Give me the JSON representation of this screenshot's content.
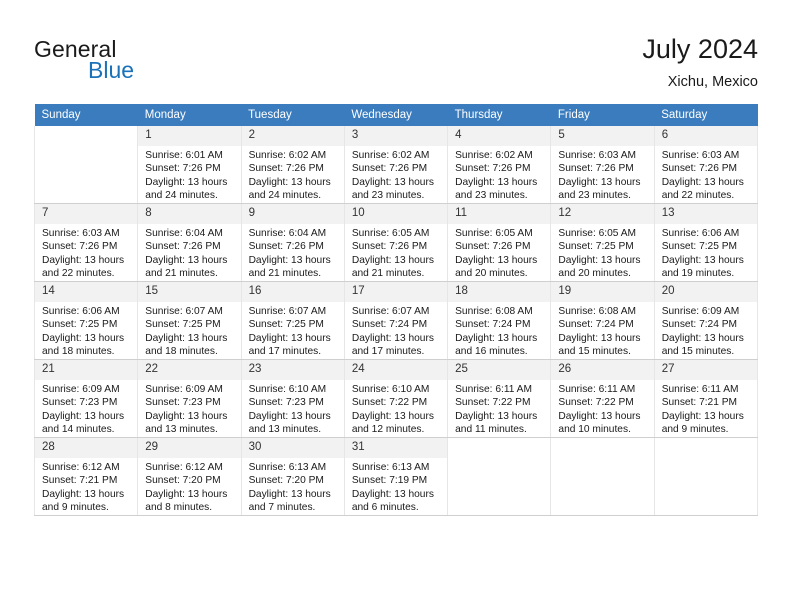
{
  "brand": {
    "name_primary": "General",
    "name_secondary": "Blue",
    "accent_color": "#1B72B8",
    "logo_icon": "triangle-flag-icon"
  },
  "header": {
    "title": "July 2024",
    "subtitle": "Xichu, Mexico"
  },
  "calendar": {
    "header_color": "#3A7CBE",
    "weekday_headers": [
      "Sunday",
      "Monday",
      "Tuesday",
      "Wednesday",
      "Thursday",
      "Friday",
      "Saturday"
    ],
    "weeks": [
      [
        {
          "day": "",
          "lines": [
            "",
            "",
            "",
            ""
          ]
        },
        {
          "day": "1",
          "lines": [
            "Sunrise: 6:01 AM",
            "Sunset: 7:26 PM",
            "Daylight: 13 hours",
            "and 24 minutes."
          ]
        },
        {
          "day": "2",
          "lines": [
            "Sunrise: 6:02 AM",
            "Sunset: 7:26 PM",
            "Daylight: 13 hours",
            "and 24 minutes."
          ]
        },
        {
          "day": "3",
          "lines": [
            "Sunrise: 6:02 AM",
            "Sunset: 7:26 PM",
            "Daylight: 13 hours",
            "and 23 minutes."
          ]
        },
        {
          "day": "4",
          "lines": [
            "Sunrise: 6:02 AM",
            "Sunset: 7:26 PM",
            "Daylight: 13 hours",
            "and 23 minutes."
          ]
        },
        {
          "day": "5",
          "lines": [
            "Sunrise: 6:03 AM",
            "Sunset: 7:26 PM",
            "Daylight: 13 hours",
            "and 23 minutes."
          ]
        },
        {
          "day": "6",
          "lines": [
            "Sunrise: 6:03 AM",
            "Sunset: 7:26 PM",
            "Daylight: 13 hours",
            "and 22 minutes."
          ]
        }
      ],
      [
        {
          "day": "7",
          "lines": [
            "Sunrise: 6:03 AM",
            "Sunset: 7:26 PM",
            "Daylight: 13 hours",
            "and 22 minutes."
          ]
        },
        {
          "day": "8",
          "lines": [
            "Sunrise: 6:04 AM",
            "Sunset: 7:26 PM",
            "Daylight: 13 hours",
            "and 21 minutes."
          ]
        },
        {
          "day": "9",
          "lines": [
            "Sunrise: 6:04 AM",
            "Sunset: 7:26 PM",
            "Daylight: 13 hours",
            "and 21 minutes."
          ]
        },
        {
          "day": "10",
          "lines": [
            "Sunrise: 6:05 AM",
            "Sunset: 7:26 PM",
            "Daylight: 13 hours",
            "and 21 minutes."
          ]
        },
        {
          "day": "11",
          "lines": [
            "Sunrise: 6:05 AM",
            "Sunset: 7:26 PM",
            "Daylight: 13 hours",
            "and 20 minutes."
          ]
        },
        {
          "day": "12",
          "lines": [
            "Sunrise: 6:05 AM",
            "Sunset: 7:25 PM",
            "Daylight: 13 hours",
            "and 20 minutes."
          ]
        },
        {
          "day": "13",
          "lines": [
            "Sunrise: 6:06 AM",
            "Sunset: 7:25 PM",
            "Daylight: 13 hours",
            "and 19 minutes."
          ]
        }
      ],
      [
        {
          "day": "14",
          "lines": [
            "Sunrise: 6:06 AM",
            "Sunset: 7:25 PM",
            "Daylight: 13 hours",
            "and 18 minutes."
          ]
        },
        {
          "day": "15",
          "lines": [
            "Sunrise: 6:07 AM",
            "Sunset: 7:25 PM",
            "Daylight: 13 hours",
            "and 18 minutes."
          ]
        },
        {
          "day": "16",
          "lines": [
            "Sunrise: 6:07 AM",
            "Sunset: 7:25 PM",
            "Daylight: 13 hours",
            "and 17 minutes."
          ]
        },
        {
          "day": "17",
          "lines": [
            "Sunrise: 6:07 AM",
            "Sunset: 7:24 PM",
            "Daylight: 13 hours",
            "and 17 minutes."
          ]
        },
        {
          "day": "18",
          "lines": [
            "Sunrise: 6:08 AM",
            "Sunset: 7:24 PM",
            "Daylight: 13 hours",
            "and 16 minutes."
          ]
        },
        {
          "day": "19",
          "lines": [
            "Sunrise: 6:08 AM",
            "Sunset: 7:24 PM",
            "Daylight: 13 hours",
            "and 15 minutes."
          ]
        },
        {
          "day": "20",
          "lines": [
            "Sunrise: 6:09 AM",
            "Sunset: 7:24 PM",
            "Daylight: 13 hours",
            "and 15 minutes."
          ]
        }
      ],
      [
        {
          "day": "21",
          "lines": [
            "Sunrise: 6:09 AM",
            "Sunset: 7:23 PM",
            "Daylight: 13 hours",
            "and 14 minutes."
          ]
        },
        {
          "day": "22",
          "lines": [
            "Sunrise: 6:09 AM",
            "Sunset: 7:23 PM",
            "Daylight: 13 hours",
            "and 13 minutes."
          ]
        },
        {
          "day": "23",
          "lines": [
            "Sunrise: 6:10 AM",
            "Sunset: 7:23 PM",
            "Daylight: 13 hours",
            "and 13 minutes."
          ]
        },
        {
          "day": "24",
          "lines": [
            "Sunrise: 6:10 AM",
            "Sunset: 7:22 PM",
            "Daylight: 13 hours",
            "and 12 minutes."
          ]
        },
        {
          "day": "25",
          "lines": [
            "Sunrise: 6:11 AM",
            "Sunset: 7:22 PM",
            "Daylight: 13 hours",
            "and 11 minutes."
          ]
        },
        {
          "day": "26",
          "lines": [
            "Sunrise: 6:11 AM",
            "Sunset: 7:22 PM",
            "Daylight: 13 hours",
            "and 10 minutes."
          ]
        },
        {
          "day": "27",
          "lines": [
            "Sunrise: 6:11 AM",
            "Sunset: 7:21 PM",
            "Daylight: 13 hours",
            "and 9 minutes."
          ]
        }
      ],
      [
        {
          "day": "28",
          "lines": [
            "Sunrise: 6:12 AM",
            "Sunset: 7:21 PM",
            "Daylight: 13 hours",
            "and 9 minutes."
          ]
        },
        {
          "day": "29",
          "lines": [
            "Sunrise: 6:12 AM",
            "Sunset: 7:20 PM",
            "Daylight: 13 hours",
            "and 8 minutes."
          ]
        },
        {
          "day": "30",
          "lines": [
            "Sunrise: 6:13 AM",
            "Sunset: 7:20 PM",
            "Daylight: 13 hours",
            "and 7 minutes."
          ]
        },
        {
          "day": "31",
          "lines": [
            "Sunrise: 6:13 AM",
            "Sunset: 7:19 PM",
            "Daylight: 13 hours",
            "and 6 minutes."
          ]
        },
        {
          "day": "",
          "lines": [
            "",
            "",
            "",
            ""
          ]
        },
        {
          "day": "",
          "lines": [
            "",
            "",
            "",
            ""
          ]
        },
        {
          "day": "",
          "lines": [
            "",
            "",
            "",
            ""
          ]
        }
      ]
    ]
  }
}
